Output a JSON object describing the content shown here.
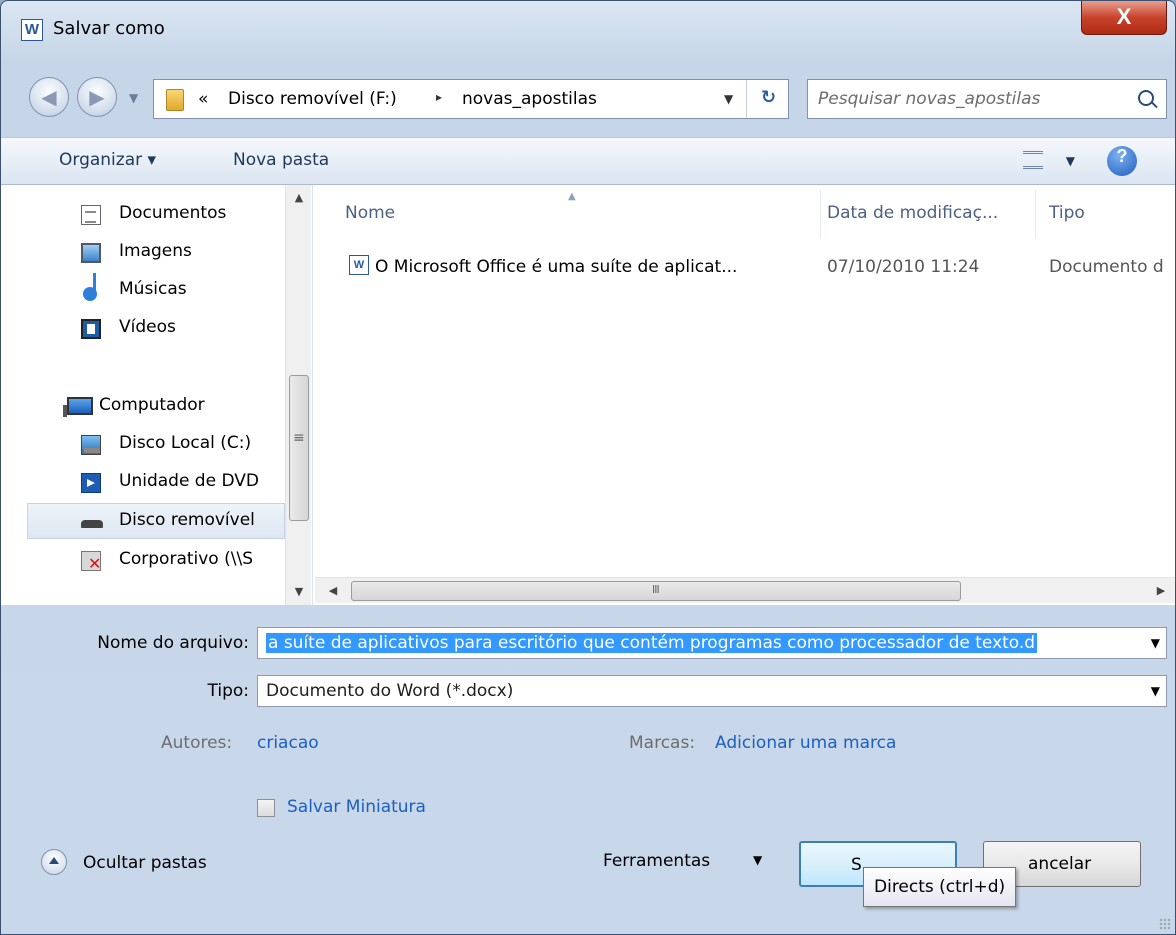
{
  "window": {
    "title": "Salvar como",
    "app_icon_letter": "W",
    "close_glyph": "X"
  },
  "address": {
    "overflow": "«",
    "crumbs": [
      "Disco removível (F:)",
      "novas_apostilas"
    ],
    "separator": "▸",
    "search_placeholder": "Pesquisar novas_apostilas"
  },
  "toolbar": {
    "organize_label": "Organizar ▾",
    "new_folder_label": "Nova pasta",
    "help_glyph": "?"
  },
  "nav": {
    "items": [
      {
        "label": "Documentos",
        "icon": "documents-icon"
      },
      {
        "label": "Imagens",
        "icon": "pictures-icon"
      },
      {
        "label": "Músicas",
        "icon": "music-icon"
      },
      {
        "label": "Vídeos",
        "icon": "videos-icon"
      },
      {
        "label": "Computador",
        "icon": "computer-icon"
      },
      {
        "label": "Disco Local (C:)",
        "icon": "hard-drive-icon"
      },
      {
        "label": "Unidade de DVD",
        "icon": "dvd-drive-icon"
      },
      {
        "label": "Disco removível",
        "icon": "removable-disk-icon",
        "selected": true
      },
      {
        "label": "Corporativo (\\\\S",
        "icon": "network-drive-icon"
      }
    ]
  },
  "files": {
    "columns": {
      "name": "Nome",
      "date": "Data de modificaç...",
      "type": "Tipo"
    },
    "rows": [
      {
        "name": "O Microsoft Office é uma suíte de aplicat...",
        "date": "07/10/2010 11:24",
        "type": "Documento d"
      }
    ]
  },
  "form": {
    "filename_label": "Nome do arquivo:",
    "filename_value": "a suíte de aplicativos para escritório que contém programas como processador de texto.d",
    "type_label": "Tipo:",
    "type_value": "Documento do Word (*.docx)",
    "authors_label": "Autores:",
    "authors_value": "criacao",
    "tags_label": "Marcas:",
    "tags_value": "Adicionar uma marca",
    "thumbnail_label": "Salvar Miniatura"
  },
  "footer": {
    "hide_folders_label": "Ocultar pastas",
    "tools_label": "Ferramentas",
    "save_label": "S",
    "cancel_label": "ancelar",
    "tooltip": "Directs (ctrl+d)"
  }
}
